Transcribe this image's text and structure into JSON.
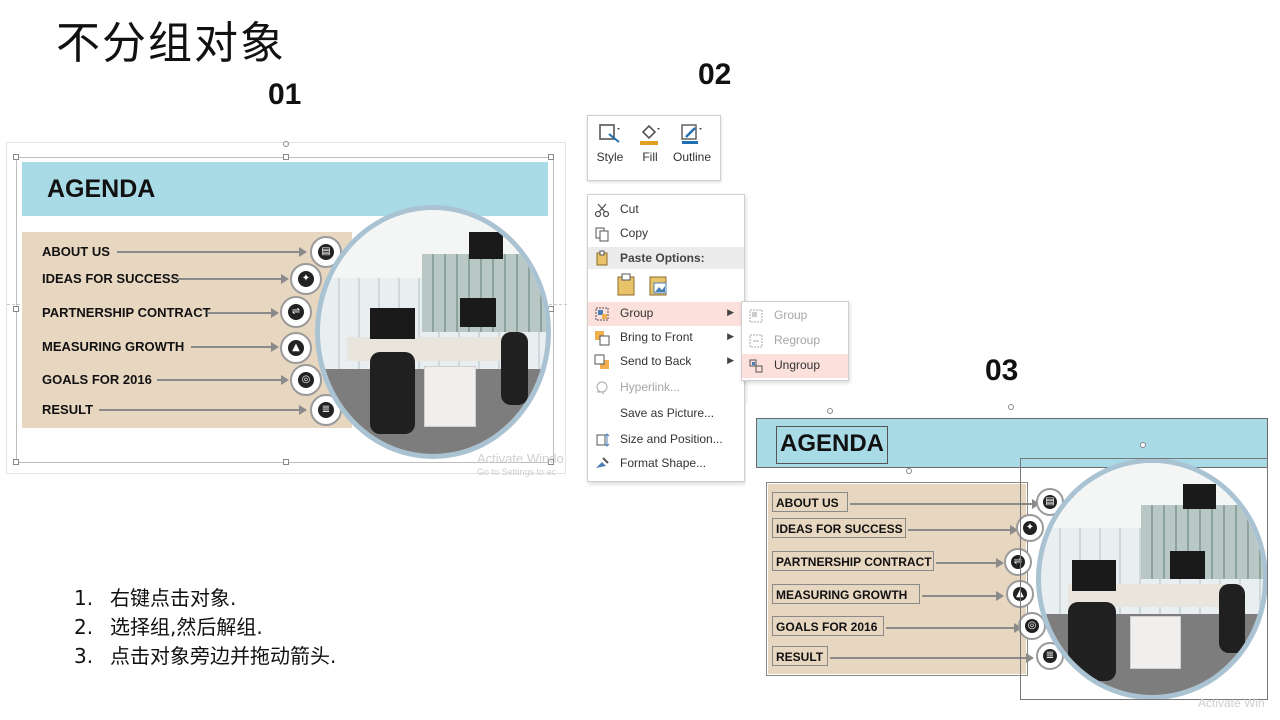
{
  "title": "不分组对象",
  "steps_numbers": {
    "s1": "01",
    "s2": "02",
    "s3": "03"
  },
  "slide": {
    "heading": "AGENDA",
    "items": [
      {
        "label": "ABOUT US",
        "icon": "book-icon"
      },
      {
        "label": "IDEAS FOR SUCCESS",
        "icon": "lightbulb-icon"
      },
      {
        "label": "PARTNERSHIP CONTRACT",
        "icon": "handshake-icon"
      },
      {
        "label": "MEASURING GROWTH",
        "icon": "growth-chart-icon"
      },
      {
        "label": "GOALS FOR 2016",
        "icon": "target-icon"
      },
      {
        "label": "RESULT",
        "icon": "document-icon"
      }
    ],
    "watermark_main": "Activate Windo",
    "watermark_sub": "Go to Settings to ac",
    "watermark_main_2": "Activate Win",
    "colors": {
      "banner": "#a8dbe6",
      "beige": "#e7d7c1",
      "ring": "#a9c3d3"
    }
  },
  "mini_toolbar": {
    "buttons": [
      {
        "label": "Style",
        "icon": "shape-style-icon"
      },
      {
        "label": "Fill",
        "icon": "paint-bucket-icon"
      },
      {
        "label": "Outline",
        "icon": "pen-outline-icon"
      }
    ]
  },
  "context_menu": {
    "cut": "Cut",
    "copy": "Copy",
    "paste_options": "Paste Options:",
    "group": "Group",
    "bring_to_front": "Bring to Front",
    "send_to_back": "Send to Back",
    "hyperlink": "Hyperlink...",
    "save_as_picture": "Save as Picture...",
    "size_position": "Size and Position...",
    "format_shape": "Format Shape...",
    "highlight_color": "#fbe0dc"
  },
  "submenu": {
    "group": "Group",
    "regroup": "Regroup",
    "ungroup": "Ungroup"
  },
  "instructions": [
    {
      "n": "1.",
      "text": "右键点击对象."
    },
    {
      "n": "2.",
      "text": "选择组,然后解组."
    },
    {
      "n": "3.",
      "text": "点击对象旁边并拖动箭头."
    }
  ]
}
